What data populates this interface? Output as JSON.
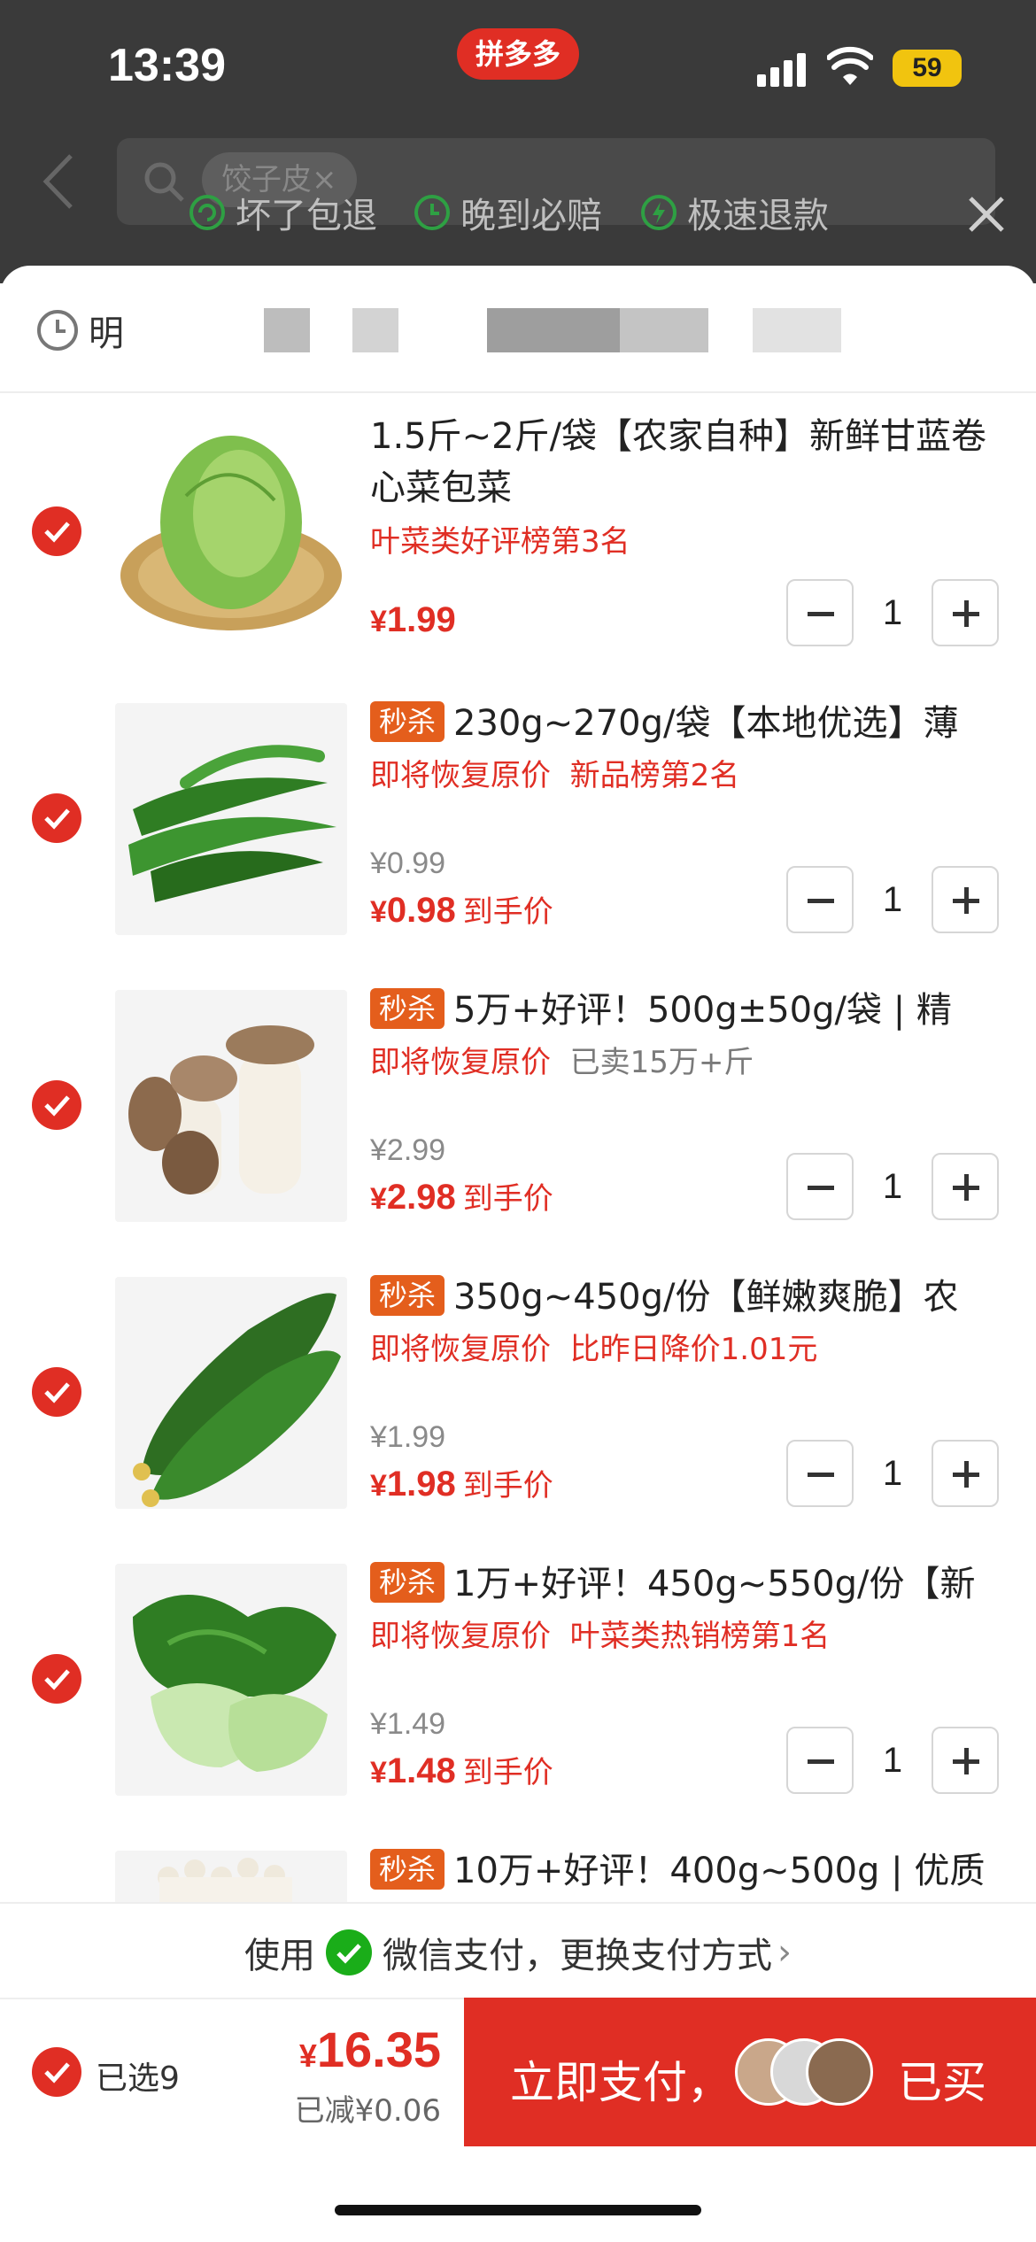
{
  "status_bar": {
    "time": "13:39",
    "app_name": "拼多多",
    "battery": "59"
  },
  "header": {
    "search_chip": "饺子皮×"
  },
  "guarantees": [
    "坏了包退",
    "晚到必赔",
    "极速退款"
  ],
  "delivery": {
    "prefix": "明"
  },
  "items": [
    {
      "title": "1.5斤~2斤/袋【农家自种】新鲜甘蓝卷心菜包菜",
      "badge": "",
      "tag_left": "叶菜类好评榜第3名",
      "tag_right": "",
      "old_price": "",
      "price_symbol": "¥",
      "price": "1.99",
      "price_suffix": "",
      "quantity": "1"
    },
    {
      "title": "230g~270g/袋【本地优选】薄",
      "badge": "秒杀",
      "tag_left": "即将恢复原价",
      "tag_right": "新品榜第2名",
      "old_price": "¥0.99",
      "price_symbol": "¥",
      "price": "0.98",
      "price_suffix": "到手价",
      "quantity": "1"
    },
    {
      "title": "5万+好评！500g±50g/袋 | 精",
      "badge": "秒杀",
      "tag_left": "即将恢复原价",
      "tag_right": "已卖15万+斤",
      "old_price": "¥2.99",
      "price_symbol": "¥",
      "price": "2.98",
      "price_suffix": "到手价",
      "quantity": "1"
    },
    {
      "title": "350g~450g/份【鲜嫩爽脆】农",
      "badge": "秒杀",
      "tag_left": "即将恢复原价",
      "tag_right": "比昨日降价1.01元",
      "old_price": "¥1.99",
      "price_symbol": "¥",
      "price": "1.98",
      "price_suffix": "到手价",
      "quantity": "1"
    },
    {
      "title": "1万+好评！450g~550g/份【新",
      "badge": "秒杀",
      "tag_left": "即将恢复原价",
      "tag_right": "叶菜类热销榜第1名",
      "old_price": "¥1.49",
      "price_symbol": "¥",
      "price": "1.48",
      "price_suffix": "到手价",
      "quantity": "1"
    },
    {
      "title": "10万+好评！400g~500g | 优质",
      "badge": "秒杀"
    }
  ],
  "payment_method": {
    "prefix": "使用",
    "text": "微信支付，更换支付方式",
    "chevron": "›"
  },
  "footer": {
    "selected": "已选9",
    "total_symbol": "¥",
    "total": "16.35",
    "discount": "已减¥0.06",
    "pay_label": "立即支付，",
    "bought": "已买"
  },
  "colors": {
    "brand": "#e02e24",
    "badge": "#e45e1c",
    "wechat": "#1aad19"
  }
}
